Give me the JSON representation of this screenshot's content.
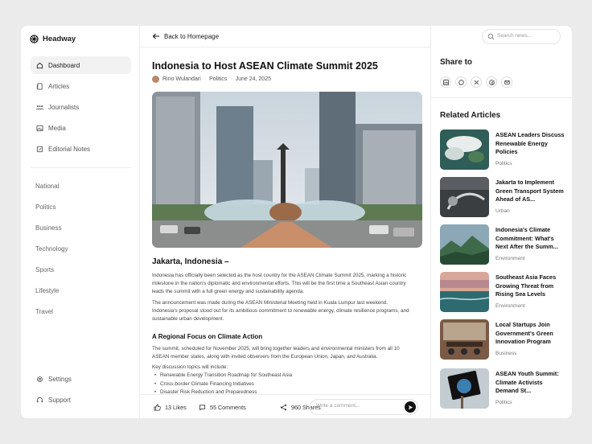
{
  "app": {
    "name": "Headway"
  },
  "sidebar": {
    "nav": [
      {
        "label": "Dashboard",
        "icon": "home-icon",
        "active": true
      },
      {
        "label": "Articles",
        "icon": "articles-icon"
      },
      {
        "label": "Journalists",
        "icon": "journalists-icon"
      },
      {
        "label": "Media",
        "icon": "media-icon"
      },
      {
        "label": "Editorial Notes",
        "icon": "notes-icon"
      }
    ],
    "categories": [
      "National",
      "Politics",
      "Business",
      "Technology",
      "Sports",
      "Lifestyle",
      "Travel"
    ],
    "bottom": [
      {
        "label": "Settings",
        "icon": "gear-icon"
      },
      {
        "label": "Support",
        "icon": "headset-icon"
      }
    ]
  },
  "topbar": {
    "back_label": "Back to Homepage"
  },
  "article": {
    "title": "Indonesia to Host ASEAN Climate Summit 2025",
    "author": "Rino Wulandari",
    "category": "Politics",
    "date": "June 24, 2025",
    "dateline": "Jakarta, Indonesia –",
    "p1": "Indonesia has officially been selected as the host country for the ASEAN Climate Summit 2025, marking a historic milestone in the nation's diplomatic and environmental efforts. This will be the first time a Southeast Asian country leads the summit with a full green energy and sustainability agenda.",
    "p2": "The announcement was made during the ASEAN Ministerial Meeting held in Kuala Lumpur last weekend. Indonesia's proposal stood out for its ambitious commitment to renewable energy, climate resilience programs, and sustainable urban development.",
    "h2": "A Regional Focus on Climate Action",
    "p3": "The summit, scheduled for November 2025, will bring together leaders and environmental ministers from all 10 ASEAN member states, along with invited observers from the European Union, Japan, and Australia.",
    "p4": "Key discussion topics will include:",
    "bullets": [
      "Renewable Energy Transition Roadmap for Southeast Asia",
      "Cross-border Climate Financing Initiatives",
      "Disaster Risk Reduction and Preparedness"
    ]
  },
  "actions": {
    "likes": "13 Likes",
    "comments": "55 Comments",
    "shares": "960 Shares",
    "comment_placeholder": "Write a comment..."
  },
  "search": {
    "placeholder": "Search news..."
  },
  "share": {
    "title": "Share to",
    "icons": [
      "linkedin-icon",
      "whatsapp-icon",
      "x-icon",
      "facebook-icon",
      "email-icon"
    ]
  },
  "related": {
    "title": "Related Articles",
    "items": [
      {
        "title": "ASEAN Leaders Discuss Renewable Energy Policies",
        "category": "Politics"
      },
      {
        "title": "Jakarta to Implement Green Transport System Ahead of AS...",
        "category": "Urban"
      },
      {
        "title": "Indonesia's Climate Commitment: What's Next After the Summ...",
        "category": "Environment"
      },
      {
        "title": "Southeast Asia Faces Growing Threat from Rising Sea Levels",
        "category": "Environment"
      },
      {
        "title": "Local Startups Join Government's Green Innovation Program",
        "category": "Business"
      },
      {
        "title": "ASEAN Youth Summit: Climate Activists Demand St...",
        "category": "Politics"
      }
    ]
  },
  "colors": {
    "accent": "#111111",
    "active_bg": "#f2f2f2",
    "border": "#ececec",
    "page_bg": "#ebebeb"
  }
}
